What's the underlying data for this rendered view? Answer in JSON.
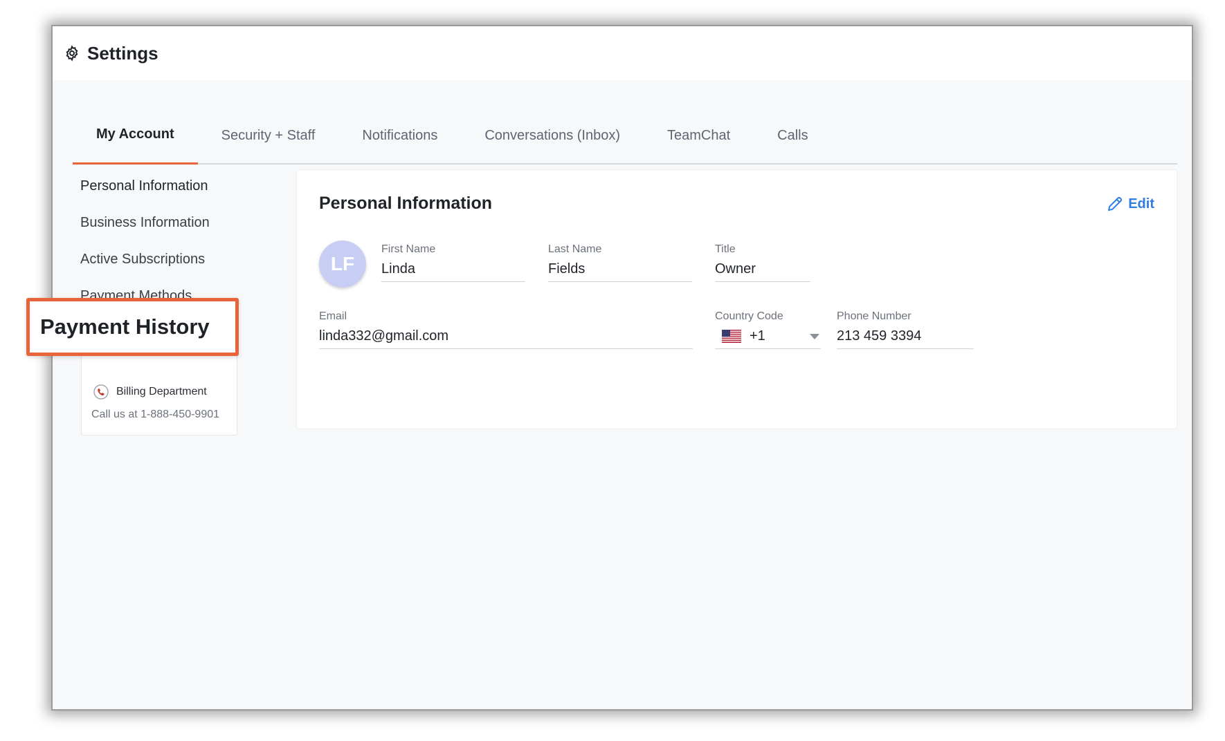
{
  "header": {
    "title": "Settings"
  },
  "tabs": [
    {
      "label": "My Account",
      "active": true
    },
    {
      "label": "Security + Staff",
      "active": false
    },
    {
      "label": "Notifications",
      "active": false
    },
    {
      "label": "Conversations (Inbox)",
      "active": false
    },
    {
      "label": "TeamChat",
      "active": false
    },
    {
      "label": "Calls",
      "active": false
    }
  ],
  "sidebar": {
    "items": [
      {
        "label": "Personal Information"
      },
      {
        "label": "Business Information"
      },
      {
        "label": "Active Subscriptions"
      },
      {
        "label": "Payment Methods"
      }
    ],
    "highlight_label": "Payment History",
    "billing": {
      "title": "Billing Department",
      "call_text": "Call us at 1-888-450-9901"
    }
  },
  "card": {
    "title": "Personal Information",
    "edit_label": "Edit",
    "avatar_initials": "LF",
    "fields": {
      "first_name": {
        "label": "First Name",
        "value": "Linda"
      },
      "last_name": {
        "label": "Last Name",
        "value": "Fields"
      },
      "title": {
        "label": "Title",
        "value": "Owner"
      },
      "email": {
        "label": "Email",
        "value": "linda332@gmail.com"
      },
      "country_code": {
        "label": "Country Code",
        "value": "+1"
      },
      "phone_number": {
        "label": "Phone Number",
        "value": "213 459 3394"
      }
    }
  },
  "colors": {
    "accent": "#e8643a",
    "link": "#2f7de1",
    "avatar": "#c8cdf3"
  }
}
